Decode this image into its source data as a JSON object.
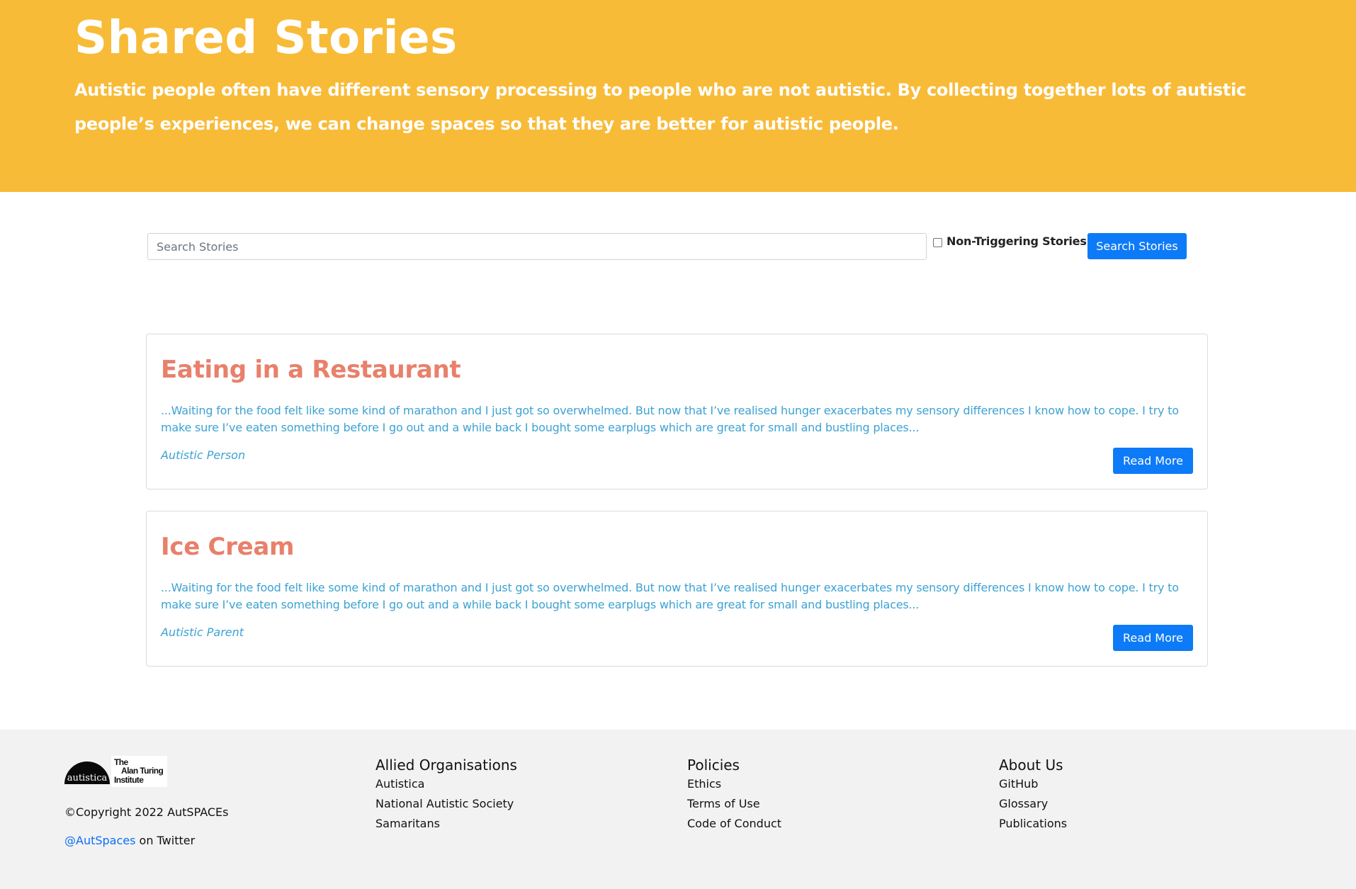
{
  "hero": {
    "title": "Shared Stories",
    "text": "Autistic people often have different sensory processing to people who are not autistic. By collecting together lots of autistic people’s experiences, we can change spaces so that they are better for autistic people."
  },
  "search": {
    "placeholder": "Search Stories",
    "non_triggering_label": "Non-Triggering Stories",
    "non_triggering_checked": false,
    "button_label": "Search Stories"
  },
  "stories": [
    {
      "title": "Eating in a Restaurant",
      "excerpt": "...Waiting for the food felt like some kind of marathon and I just got so overwhelmed. But now that I’ve realised hunger exacerbates my sensory differences I know how to cope. I try to make sure I’ve eaten something before I go out and a while back I bought some earplugs which are great for small and bustling places...",
      "author": "Autistic Person",
      "button_label": "Read More"
    },
    {
      "title": "Ice Cream",
      "excerpt": "...Waiting for the food felt like some kind of marathon and I just got so overwhelmed. But now that I’ve realised hunger exacerbates my sensory differences I know how to cope. I try to make sure I’ve eaten something before I go out and a while back I bought some earplugs which are great for small and bustling places...",
      "author": "Autistic Parent",
      "button_label": "Read More"
    }
  ],
  "footer": {
    "logo_autistica": "autistica",
    "logo_turing": "The Alan Turing Institute",
    "copyright": "©Copyright 2022 AutSPACEs",
    "twitter_handle": "@AutSpaces",
    "twitter_suffix": " on Twitter",
    "columns": [
      {
        "title": "Allied Organisations",
        "links": [
          "Autistica",
          "National Autistic Society",
          "Samaritans"
        ]
      },
      {
        "title": "Policies",
        "links": [
          "Ethics",
          "Terms of Use",
          "Code of Conduct"
        ]
      },
      {
        "title": "About Us",
        "links": [
          "GitHub",
          "Glossary",
          "Publications"
        ]
      }
    ]
  },
  "colors": {
    "hero_background": "#f8bb38",
    "primary_button": "#0d7bf7",
    "story_title": "#e8806b",
    "story_text": "#3ca2d3",
    "footer_background": "#f2f2f2"
  }
}
